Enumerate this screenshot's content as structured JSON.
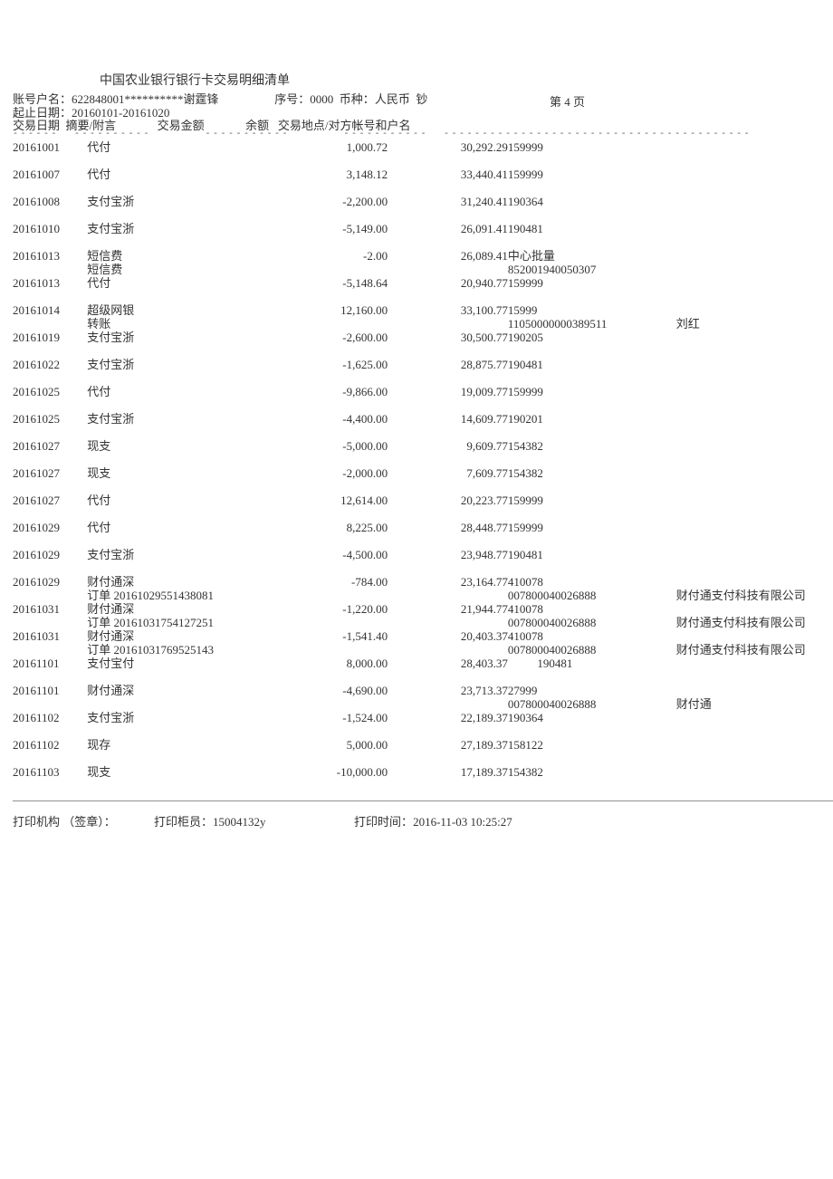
{
  "doc": {
    "title": "中国农业银行银行卡交易明细清单",
    "page_label": "第 4 页",
    "account_label": "账号户名：",
    "account_value": "622848001**********谢霆锋",
    "seq_label": "序号：",
    "seq_value": "0000",
    "currency_label": "币种：",
    "currency_value": "人民币",
    "cash_flag": "钞",
    "daterange_label": "起止日期：",
    "daterange_value": "20160101-20161020",
    "col_date": "交易日期",
    "col_desc": "摘要/附言",
    "col_amt": "交易金额",
    "col_bal": "余额",
    "col_loc": "交易地点/对方帐号和户名",
    "footer_org_label": "打印机构",
    "footer_org_seal": "（签章）：",
    "footer_teller_label": "打印柜员：",
    "footer_teller_value": "15004132y",
    "footer_time_label": "打印时间：",
    "footer_time_value": "2016-11-03 10:25:27"
  },
  "rows": [
    {
      "date": "20161001",
      "desc": "代付",
      "amt": "1,000.72",
      "bal": "30,292.29",
      "loc": "159999",
      "sub": "",
      "loc2": "",
      "ext": "",
      "space": 0
    },
    {
      "date": "20161007",
      "desc": "代付",
      "amt": "3,148.12",
      "bal": "33,440.41",
      "loc": "159999",
      "sub": "",
      "loc2": "",
      "ext": "",
      "space": 1
    },
    {
      "date": "20161008",
      "desc": "支付宝浙",
      "amt": "-2,200.00",
      "bal": "31,240.41",
      "loc": "190364",
      "sub": "",
      "loc2": "",
      "ext": "",
      "space": 1
    },
    {
      "date": "20161010",
      "desc": "支付宝浙",
      "amt": "-5,149.00",
      "bal": "26,091.41",
      "loc": "190481",
      "sub": "",
      "loc2": "",
      "ext": "",
      "space": 1
    },
    {
      "date": "20161013",
      "desc": "短信费",
      "amt": "-2.00",
      "bal": "26,089.41",
      "loc": "中心批量",
      "sub": "短信费",
      "loc2": "852001940050307",
      "ext": "",
      "space": 1
    },
    {
      "date": "20161013",
      "desc": "代付",
      "amt": "-5,148.64",
      "bal": "20,940.77",
      "loc": "159999",
      "sub": "",
      "loc2": "",
      "ext": "",
      "space": 0
    },
    {
      "date": "20161014",
      "desc": "超级网银",
      "amt": "12,160.00",
      "bal": "33,100.77",
      "loc": "15999",
      "sub": "转账",
      "loc2": "11050000000389511",
      "ext": "刘红",
      "space": 1
    },
    {
      "date": "20161019",
      "desc": "支付宝浙",
      "amt": "-2,600.00",
      "bal": "30,500.77",
      "loc": "190205",
      "sub": "",
      "loc2": "",
      "ext": "",
      "space": 0
    },
    {
      "date": "20161022",
      "desc": "支付宝浙",
      "amt": "-1,625.00",
      "bal": "28,875.77",
      "loc": "190481",
      "sub": "",
      "loc2": "",
      "ext": "",
      "space": 1
    },
    {
      "date": "20161025",
      "desc": "代付",
      "amt": "-9,866.00",
      "bal": "19,009.77",
      "loc": "159999",
      "sub": "",
      "loc2": "",
      "ext": "",
      "space": 1
    },
    {
      "date": "20161025",
      "desc": "支付宝浙",
      "amt": "-4,400.00",
      "bal": "14,609.77",
      "loc": "190201",
      "sub": "",
      "loc2": "",
      "ext": "",
      "space": 1
    },
    {
      "date": "20161027",
      "desc": "现支",
      "amt": "-5,000.00",
      "bal": "9,609.77",
      "loc": "154382",
      "sub": "",
      "loc2": "",
      "ext": "",
      "space": 1
    },
    {
      "date": "20161027",
      "desc": "现支",
      "amt": "-2,000.00",
      "bal": "7,609.77",
      "loc": "154382",
      "sub": "",
      "loc2": "",
      "ext": "",
      "space": 1
    },
    {
      "date": "20161027",
      "desc": "代付",
      "amt": "12,614.00",
      "bal": "20,223.77",
      "loc": "159999",
      "sub": "",
      "loc2": "",
      "ext": "",
      "space": 1
    },
    {
      "date": "20161029",
      "desc": "代付",
      "amt": "8,225.00",
      "bal": "28,448.77",
      "loc": "159999",
      "sub": "",
      "loc2": "",
      "ext": "",
      "space": 1
    },
    {
      "date": "20161029",
      "desc": "支付宝浙",
      "amt": "-4,500.00",
      "bal": "23,948.77",
      "loc": "190481",
      "sub": "",
      "loc2": "",
      "ext": "",
      "space": 1
    },
    {
      "date": "20161029",
      "desc": "财付通深",
      "amt": "-784.00",
      "bal": "23,164.77",
      "loc": "410078",
      "sub": "订单 20161029551438081",
      "loc2": "007800040026888",
      "ext": "财付通支付科技有限公司",
      "space": 1
    },
    {
      "date": "20161031",
      "desc": "财付通深",
      "amt": "-1,220.00",
      "bal": "21,944.77",
      "loc": "410078",
      "sub": "订单 20161031754127251",
      "loc2": "007800040026888",
      "ext": "财付通支付科技有限公司",
      "space": 0
    },
    {
      "date": "20161031",
      "desc": "财付通深",
      "amt": "-1,541.40",
      "bal": "20,403.37",
      "loc": "410078",
      "sub": "订单 20161031769525143",
      "loc2": "007800040026888",
      "ext": "财付通支付科技有限公司",
      "space": 0
    },
    {
      "date": "20161101",
      "desc": "支付宝付",
      "amt": "8,000.00",
      "bal": "28,403.37",
      "loc": "          190481",
      "sub": "",
      "loc2": "",
      "ext": "",
      "space": 0
    },
    {
      "date": "20161101",
      "desc": "财付通深",
      "amt": "-4,690.00",
      "bal": "23,713.37",
      "loc": "27999",
      "sub": "",
      "loc2": "007800040026888",
      "ext": "财付通",
      "space": 1
    },
    {
      "date": "20161102",
      "desc": "支付宝浙",
      "amt": "-1,524.00",
      "bal": "22,189.37",
      "loc": "190364",
      "sub": "",
      "loc2": "",
      "ext": "",
      "space": 0
    },
    {
      "date": "20161102",
      "desc": "现存",
      "amt": "5,000.00",
      "bal": "27,189.37",
      "loc": "158122",
      "sub": "",
      "loc2": "",
      "ext": "",
      "space": 1
    },
    {
      "date": "20161103",
      "desc": "现支",
      "amt": "-10,000.00",
      "bal": "17,189.37",
      "loc": "154382",
      "sub": "",
      "loc2": "",
      "ext": "",
      "space": 1
    }
  ]
}
